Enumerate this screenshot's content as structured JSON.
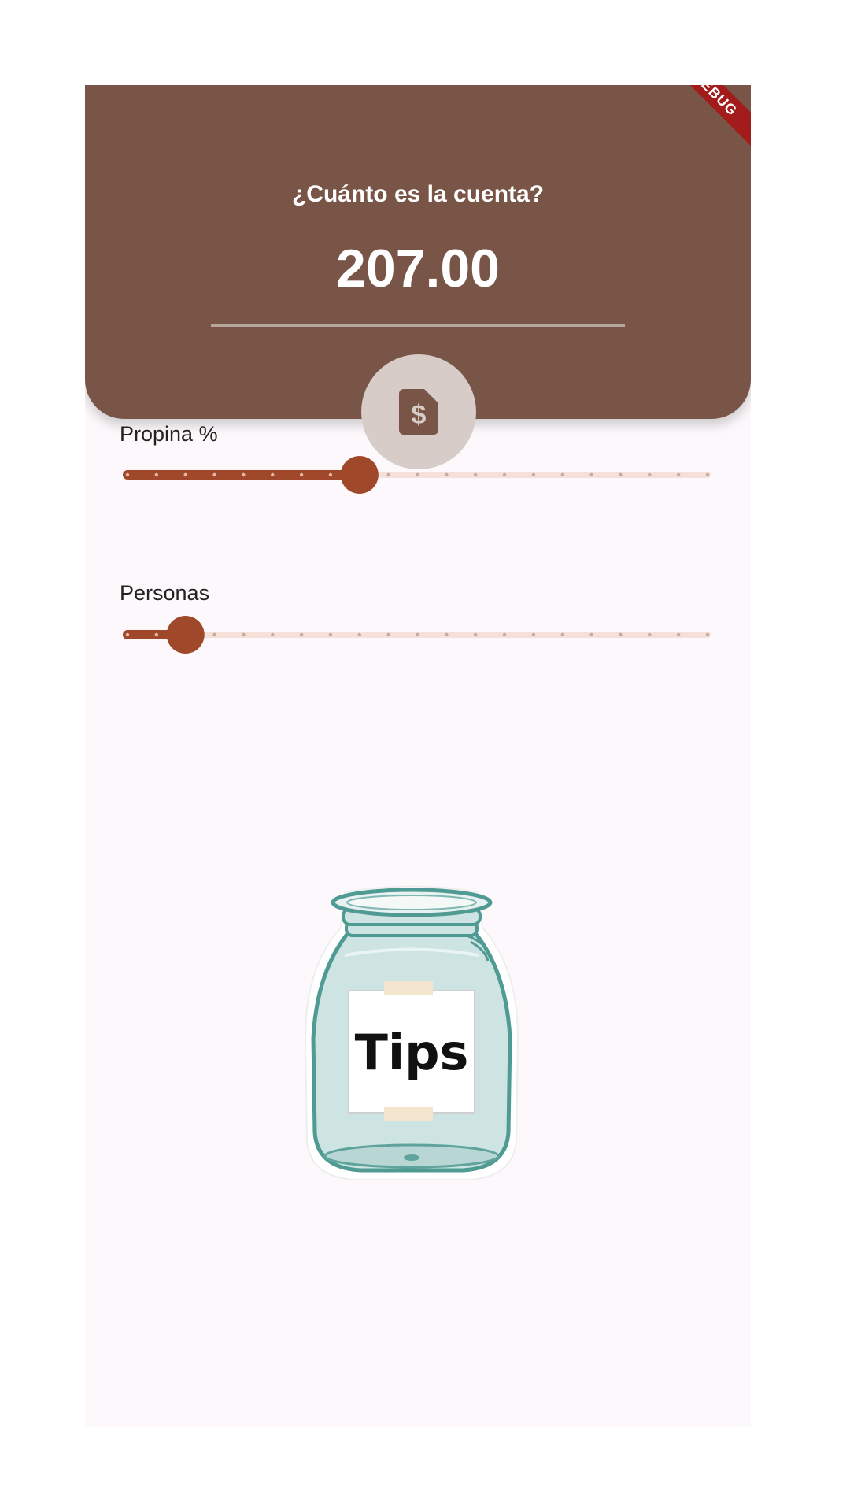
{
  "header": {
    "question": "¿Cuánto es la cuenta?",
    "amount": "207.00",
    "debug_banner": "DEBUG"
  },
  "bill_button": {
    "icon": "receipt-dollar-icon"
  },
  "tip_slider": {
    "label": "Propina %",
    "value_fraction": 0.4,
    "divisions": 20
  },
  "people_slider": {
    "label": "Personas",
    "value_fraction": 0.1,
    "divisions": 20
  },
  "jar_image": {
    "label": "Tips"
  },
  "colors": {
    "header": "#795548",
    "accent": "#a0482a",
    "track_inactive": "#f5e0da",
    "fab": "#d7ccc8",
    "background": "#fcf8fb"
  }
}
